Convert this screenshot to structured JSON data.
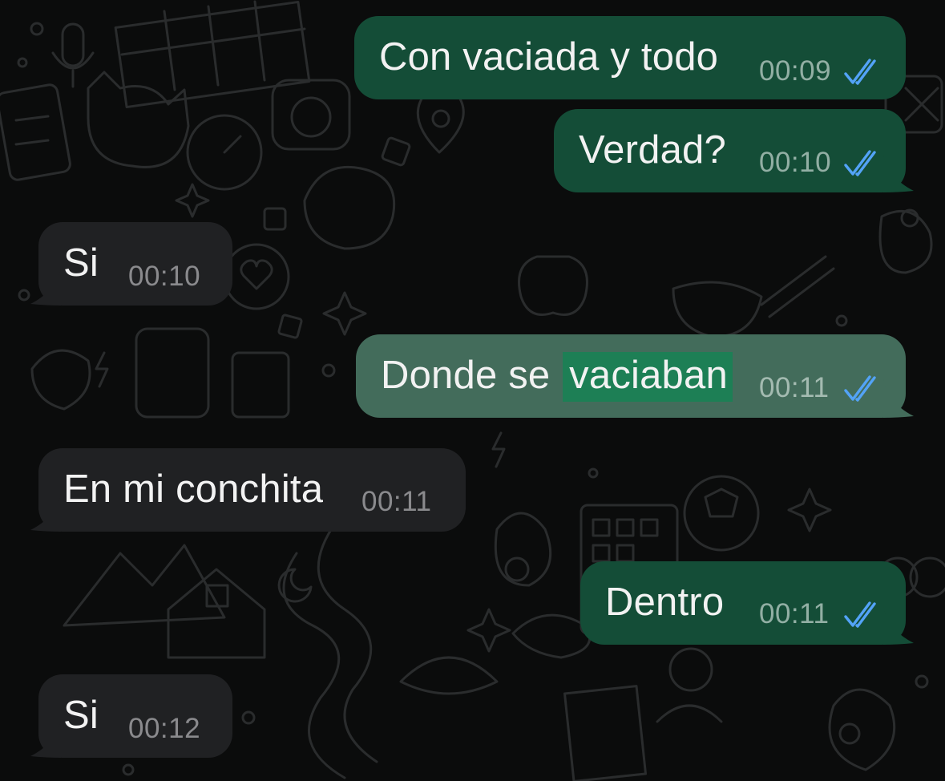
{
  "colors": {
    "background": "#0b0c0c",
    "outgoing_bubble": "#144d37",
    "outgoing_bubble_selected": "#436c5b",
    "incoming_bubble": "#202123",
    "search_highlight": "#1d7f55",
    "read_ticks": "#53a3f7"
  },
  "messages": [
    {
      "direction": "outgoing",
      "text": "Con vaciada y todo",
      "time": "00:09",
      "status": "read"
    },
    {
      "direction": "outgoing",
      "text": "Verdad?",
      "time": "00:10",
      "status": "read"
    },
    {
      "direction": "incoming",
      "text": "Si",
      "time": "00:10"
    },
    {
      "direction": "outgoing",
      "text_before": "Donde se ",
      "text_highlight": "vaciaban",
      "time": "00:11",
      "status": "read",
      "selected": true
    },
    {
      "direction": "incoming",
      "text": "En mi conchita",
      "time": "00:11"
    },
    {
      "direction": "outgoing",
      "text": "Dentro",
      "time": "00:11",
      "status": "read"
    },
    {
      "direction": "incoming",
      "text": "Si",
      "time": "00:12"
    }
  ],
  "icons": {
    "read_receipt": "double-check-icon",
    "wallpaper": "doodle-pattern"
  }
}
